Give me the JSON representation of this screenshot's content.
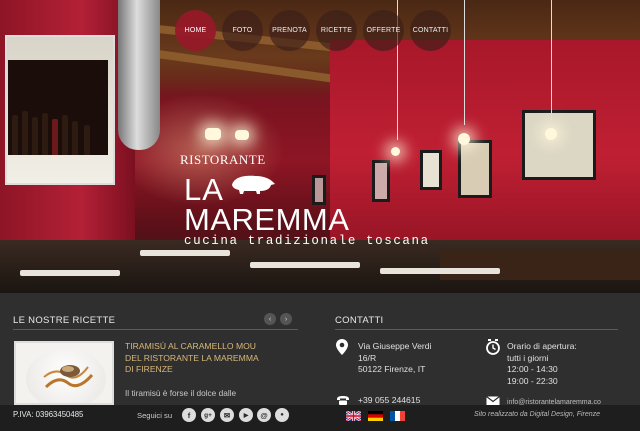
{
  "nav": {
    "items": [
      {
        "label": "HOME",
        "active": true
      },
      {
        "label": "FOTO",
        "active": false
      },
      {
        "label": "PRENOTA",
        "active": false
      },
      {
        "label": "RICETTE",
        "active": false
      },
      {
        "label": "OFFERTE",
        "active": false
      },
      {
        "label": "CONTATTI",
        "active": false
      }
    ]
  },
  "logo": {
    "top": "RISTORANTE",
    "la": "LA",
    "name": "MAREMMA",
    "tagline": "cucina tradizionale toscana"
  },
  "recipes": {
    "title": "LE NOSTRE RICETTE",
    "prev_icon": "chevron-left-icon",
    "next_icon": "chevron-right-icon",
    "item": {
      "title": "TIRAMISÙ AL CARAMELLO MOU DEL RISTORANTE LA MAREMMA DI FIRENZE",
      "excerpt": "Il tiramisù è forse il dolce dalle"
    }
  },
  "contacts": {
    "title": "CONTATTI",
    "address": [
      "Via Giuseppe Verdi",
      "16/R",
      "50122 Firenze, IT"
    ],
    "phone": "+39 055 244615",
    "hours_title": "Orario di apertura:",
    "hours_days": "tutti i giorni",
    "hours": [
      "12:00 - 14:30",
      "19:00 - 22:30"
    ],
    "email": "info@ristorantelamaremma.co"
  },
  "footer": {
    "piva": "P.IVA: 03963450485",
    "follow": "Seguici su",
    "social": [
      {
        "icon": "facebook-icon",
        "glyph": "f"
      },
      {
        "icon": "google-plus-icon",
        "glyph": "g+"
      },
      {
        "icon": "tripadvisor-icon",
        "glyph": "✉"
      },
      {
        "icon": "youtube-icon",
        "glyph": "▶"
      },
      {
        "icon": "email-icon",
        "glyph": "@"
      },
      {
        "icon": "map-pin-icon",
        "glyph": "●"
      }
    ],
    "languages": [
      "en",
      "de",
      "fr"
    ],
    "credit": "Sito realizzato da Digital Design, Firenze"
  },
  "colors": {
    "accent_red": "#961928",
    "recipe_title": "#d9b878",
    "footer_bg": "#1e1e1e",
    "panel_bg": "#2f2f2f"
  }
}
